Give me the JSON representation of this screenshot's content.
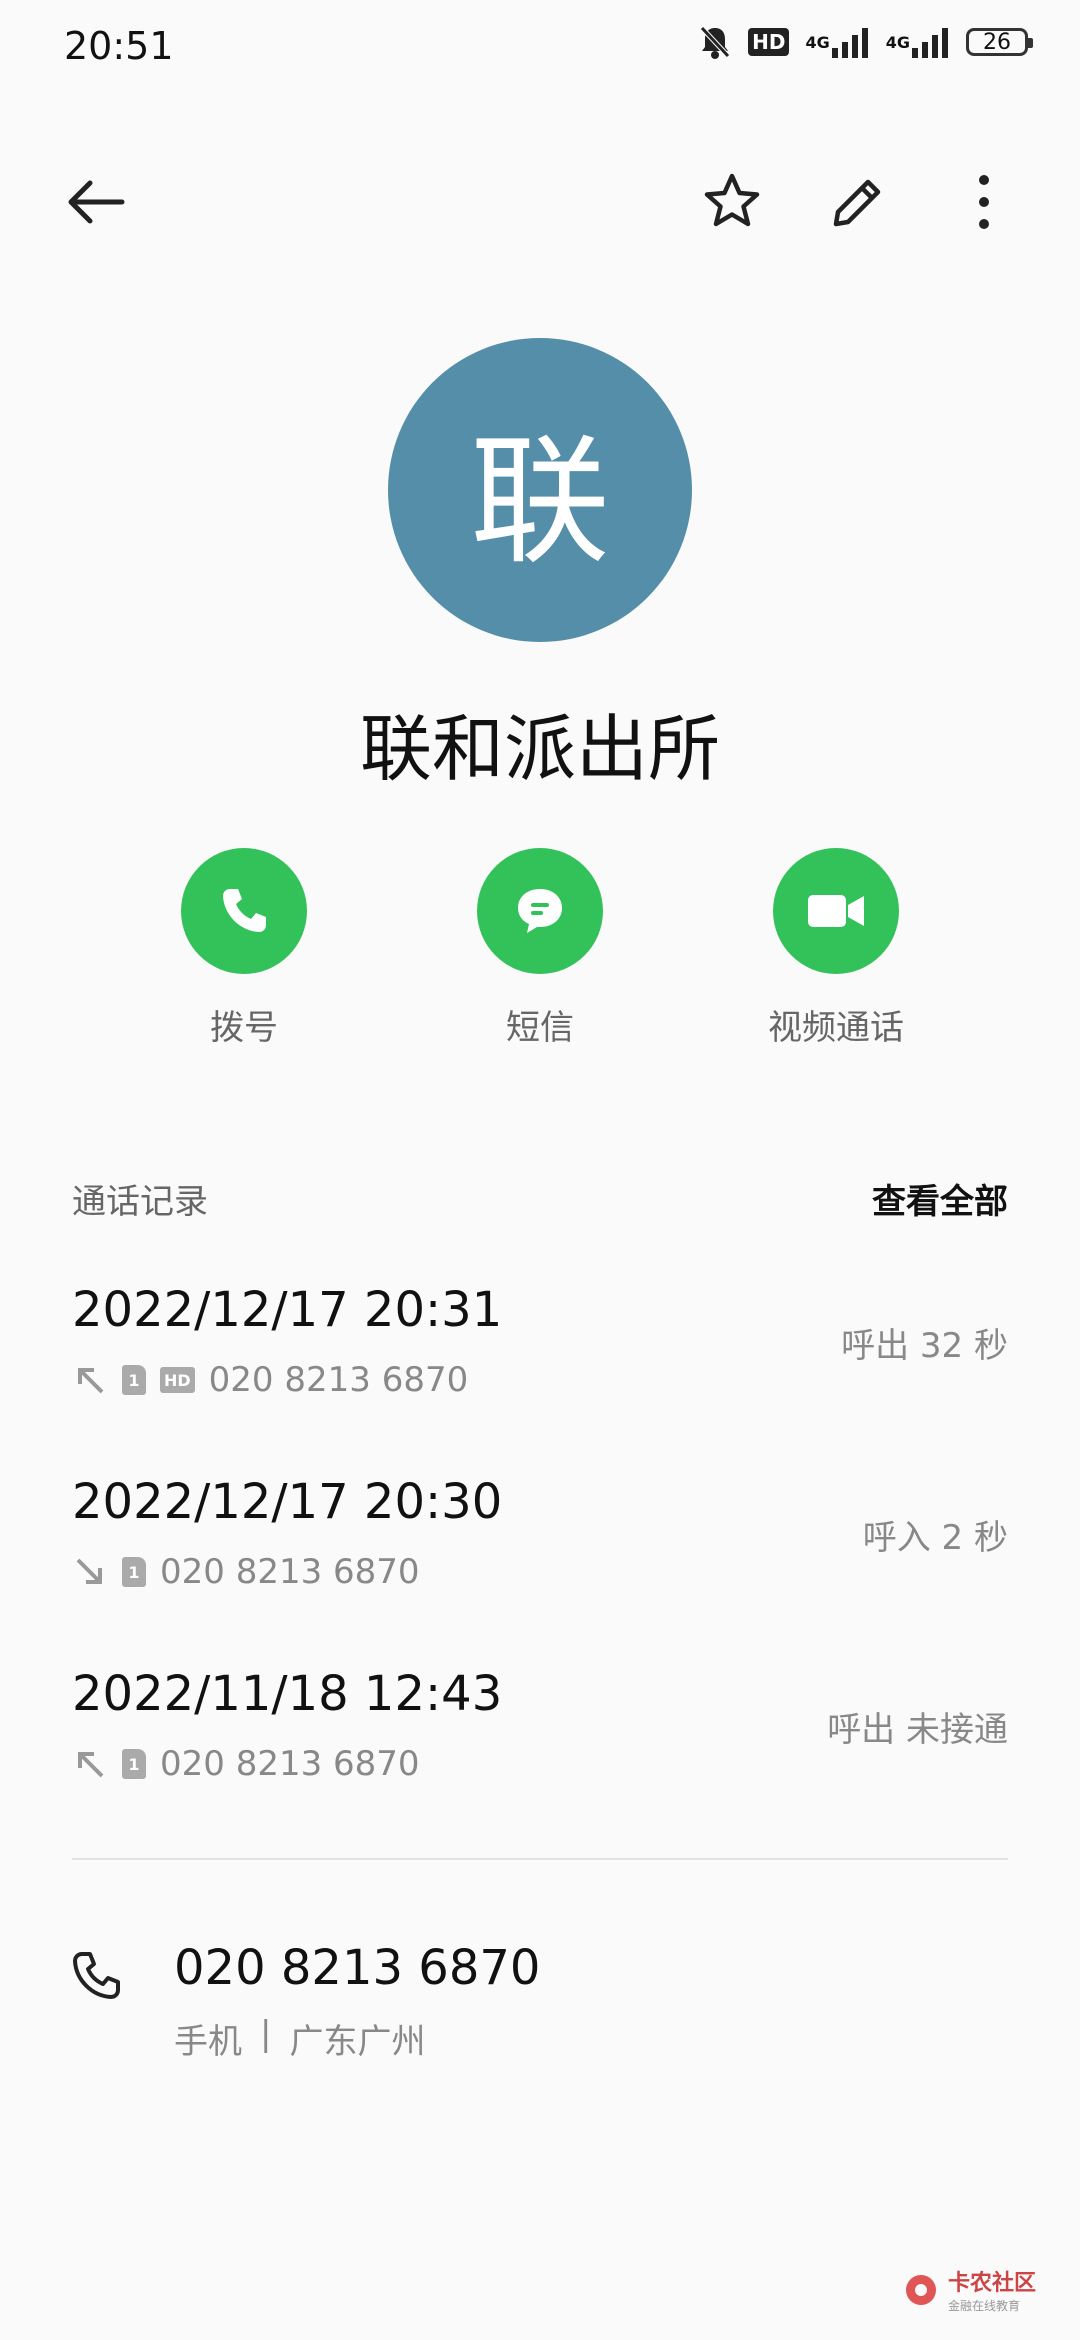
{
  "status_bar": {
    "time": "20:51",
    "hd_label": "HD",
    "sig1": "4G",
    "sig2": "4G",
    "battery": "26",
    "icons": [
      "bell-off-icon",
      "hd-icon",
      "signal-icon",
      "signal-icon",
      "battery-icon"
    ]
  },
  "toolbar": {
    "icons": [
      "back-arrow-icon",
      "star-icon",
      "edit-pencil-icon",
      "more-vertical-icon"
    ]
  },
  "contact": {
    "avatar_letter": "联",
    "avatar_color": "#558ea9",
    "name": "联和派出所"
  },
  "actions": [
    {
      "label": "拨号",
      "icon": "phone-icon"
    },
    {
      "label": "短信",
      "icon": "message-icon"
    },
    {
      "label": "视频通话",
      "icon": "video-camera-icon"
    }
  ],
  "action_color": "#33c25a",
  "call_log": {
    "title": "通话记录",
    "view_all": "查看全部",
    "items": [
      {
        "date": "2022/12/17 20:31",
        "direction": "outgoing",
        "sim": "1",
        "hd": "HD",
        "number": "020 8213 6870",
        "status": "呼出  32 秒"
      },
      {
        "date": "2022/12/17 20:30",
        "direction": "incoming",
        "sim": "1",
        "number": "020 8213 6870",
        "status": "呼入  2 秒"
      },
      {
        "date": "2022/11/18 12:43",
        "direction": "outgoing",
        "sim": "1",
        "number": "020 8213 6870",
        "status": "呼出 未接通"
      }
    ]
  },
  "phone": {
    "number": "020 8213 6870",
    "type": "手机",
    "separator": "|",
    "location": "广东广州"
  },
  "watermark": {
    "text1": "卡农社区",
    "text2": "金融在线教育"
  }
}
